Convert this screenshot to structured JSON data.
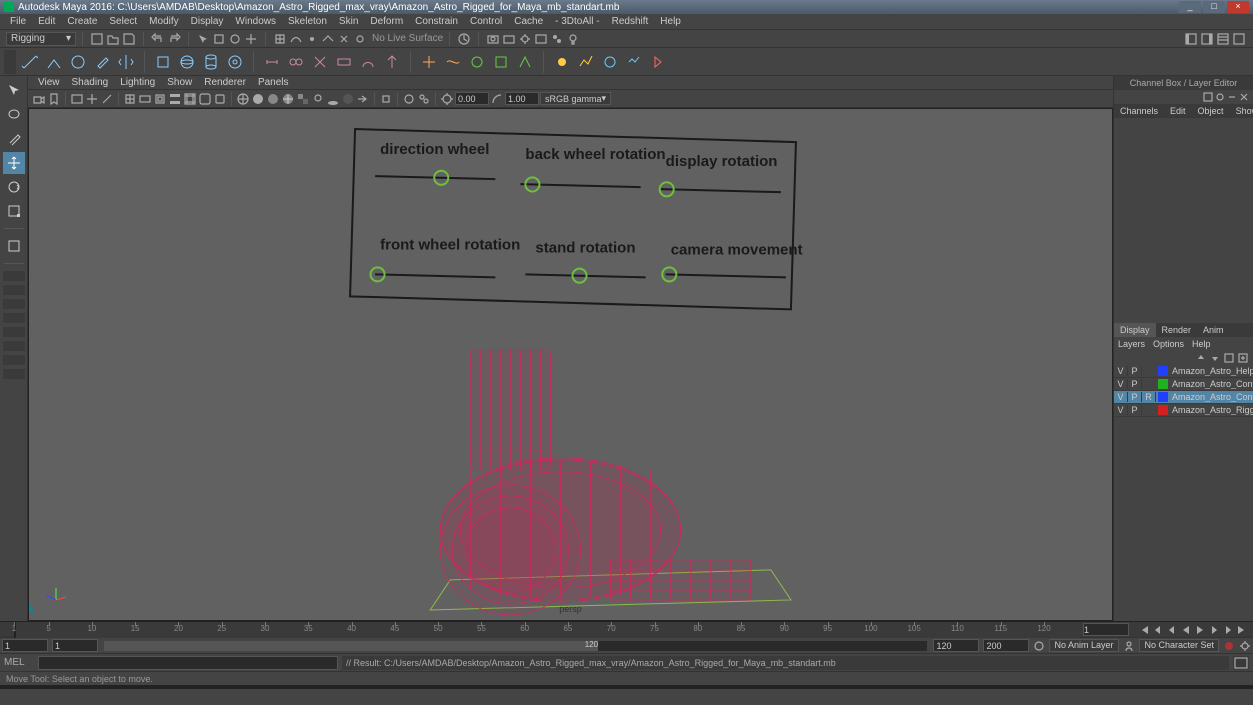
{
  "window": {
    "title": "Autodesk Maya 2016: C:\\Users\\AMDAB\\Desktop\\Amazon_Astro_Rigged_max_vray\\Amazon_Astro_Rigged_for_Maya_mb_standart.mb"
  },
  "menubar": [
    "File",
    "Edit",
    "Create",
    "Select",
    "Modify",
    "Display",
    "Windows",
    "Skeleton",
    "Skin",
    "Deform",
    "Constrain",
    "Control",
    "Cache",
    "- 3DtoAll -",
    "Redshift",
    "Help"
  ],
  "status": {
    "mode": "Rigging",
    "nolive": "No Live Surface"
  },
  "panel_menubar": [
    "View",
    "Shading",
    "Lighting",
    "Show",
    "Renderer",
    "Panels"
  ],
  "panel_toolbar": {
    "near": "0.00",
    "far": "1.00",
    "colorspace": "sRGB gamma"
  },
  "viewport": {
    "camera": "persp",
    "controls": [
      "direction wheel",
      "back wheel rotation",
      "display rotation",
      "front wheel rotation",
      "stand rotation",
      "camera movement"
    ]
  },
  "channelbox": {
    "title": "Channel Box / Layer Editor",
    "top_tabs": [
      "Channels",
      "Edit",
      "Object",
      "Show"
    ],
    "display_tabs": [
      "Display",
      "Render",
      "Anim"
    ],
    "layer_menu": [
      "Layers",
      "Options",
      "Help"
    ],
    "layers": [
      {
        "v": "V",
        "p": "P",
        "r": "",
        "color": "#2040ff",
        "name": "Amazon_Astro_Helpers",
        "sel": false
      },
      {
        "v": "V",
        "p": "P",
        "r": "",
        "color": "#20b020",
        "name": "Amazon_Astro_Contro",
        "sel": false
      },
      {
        "v": "V",
        "p": "P",
        "r": "R",
        "color": "#2040ff",
        "name": "Amazon_Astro_Contro",
        "sel": true
      },
      {
        "v": "V",
        "p": "P",
        "r": "",
        "color": "#d02020",
        "name": "Amazon_Astro_Rigged",
        "sel": false
      }
    ]
  },
  "timeline": {
    "start_vis": "1",
    "end_vis": "120",
    "start": "1",
    "end": "120",
    "range_end": "200",
    "current": "1",
    "animlayer": "No Anim Layer",
    "charset": "No Character Set",
    "ticks": [
      1,
      5,
      10,
      15,
      20,
      25,
      30,
      35,
      40,
      45,
      50,
      55,
      60,
      65,
      70,
      75,
      80,
      85,
      90,
      95,
      100,
      105,
      110,
      115,
      120
    ]
  },
  "command": {
    "lang": "MEL",
    "result": "// Result: C:/Users/AMDAB/Desktop/Amazon_Astro_Rigged_max_vray/Amazon_Astro_Rigged_for_Maya_mb_standart.mb"
  },
  "helpline": "Move Tool: Select an object to move."
}
